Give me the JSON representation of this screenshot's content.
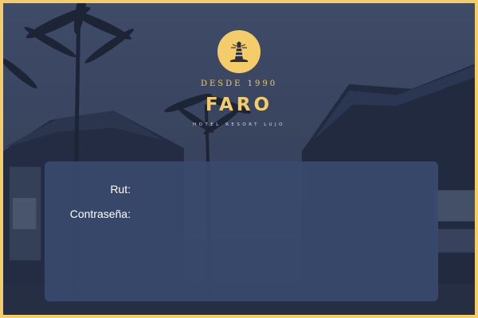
{
  "brand": {
    "since": "DESDE 1990",
    "name": "FARO",
    "tagline": "HOTEL RESORT LUJO",
    "logo_icon": "lighthouse-icon"
  },
  "login": {
    "rut_label": "Rut:",
    "rut_value": "",
    "password_label": "Contraseña:",
    "password_value": ""
  },
  "colors": {
    "accent": "#f4cc6a",
    "panel": "#384a6e",
    "background": "#3f4a66"
  }
}
